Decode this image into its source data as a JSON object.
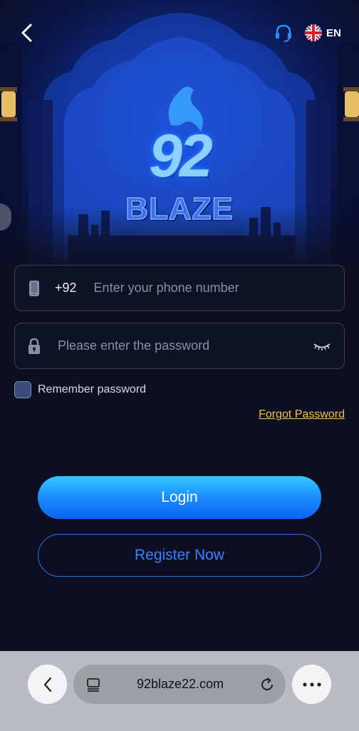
{
  "header": {
    "language": "EN",
    "back_icon": "chevron-left-icon",
    "support_icon": "headset-icon",
    "flag_icon": "uk-flag-icon"
  },
  "logo": {
    "number": "92",
    "word": "BLAZE"
  },
  "form": {
    "phone_prefix": "+92",
    "phone_placeholder": "Enter your phone number",
    "password_placeholder": "Please enter the password",
    "remember_label": "Remember password",
    "remember_checked": false,
    "forgot_label": "Forgot Password",
    "login_label": "Login",
    "register_label": "Register Now"
  },
  "browser": {
    "url": "92blaze22.com"
  },
  "colors": {
    "accent": "#1a8cff",
    "link": "#f3c24b",
    "background": "#0c0f22"
  }
}
